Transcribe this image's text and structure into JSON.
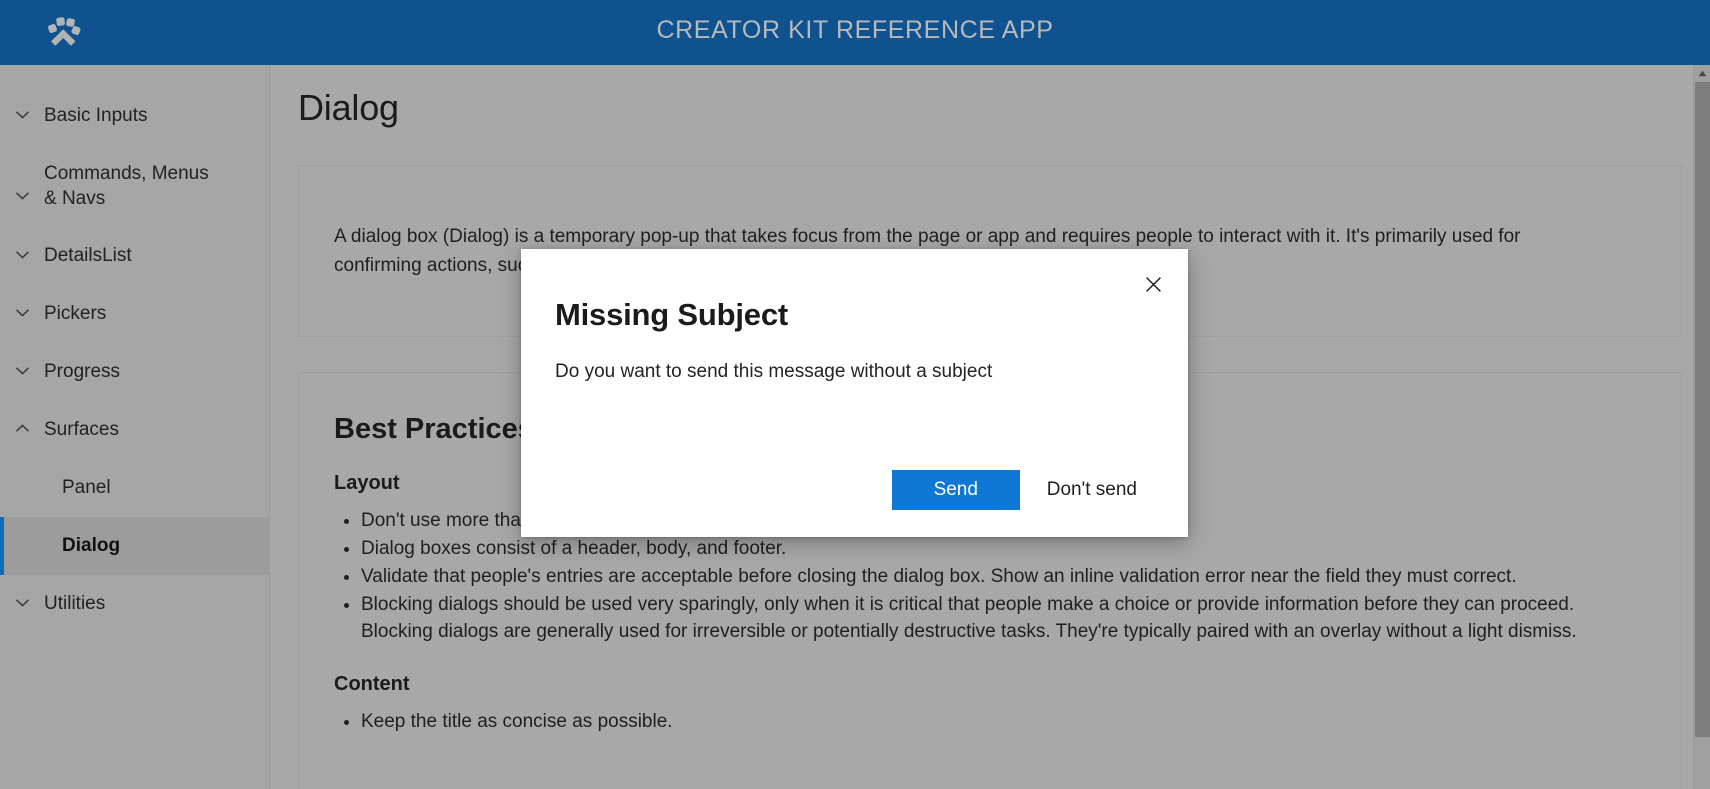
{
  "header": {
    "logo_icon": "paw-logo-icon",
    "title": "CREATOR KIT REFERENCE APP",
    "background_color": "#0e5390",
    "title_color": "#b9b9b9"
  },
  "sidebar": {
    "items": [
      {
        "label": "Basic Inputs",
        "icon": "chevron-down-icon",
        "expanded": false
      },
      {
        "label": "Commands, Menus & Navs",
        "icon": "chevron-down-icon",
        "expanded": false
      },
      {
        "label": "DetailsList",
        "icon": "chevron-down-icon",
        "expanded": false
      },
      {
        "label": "Pickers",
        "icon": "chevron-down-icon",
        "expanded": false
      },
      {
        "label": "Progress",
        "icon": "chevron-down-icon",
        "expanded": false
      },
      {
        "label": "Surfaces",
        "icon": "chevron-up-icon",
        "expanded": true
      },
      {
        "label": "Utilities",
        "icon": "chevron-down-icon",
        "expanded": false
      }
    ],
    "surfaces_children": [
      {
        "label": "Panel",
        "selected": false
      },
      {
        "label": "Dialog",
        "selected": true
      }
    ],
    "selection_accent_color": "#0f6cbd",
    "background_color": "#a6a6a6"
  },
  "main": {
    "page_title": "Dialog",
    "description": "A dialog box (Dialog) is a temporary pop-up that takes focus from the page or app and requires people to interact with it. It's primarily used for confirming actions, such as deleting a file, or asking people to make a choice.",
    "best_practices_heading": "Best Practices",
    "layout_heading": "Layout",
    "layout_bullets": [
      "Don't use more than three buttons.",
      "Dialog boxes consist of a header, body, and footer.",
      "Validate that people's entries are acceptable before closing the dialog box. Show an inline validation error near the field they must correct.",
      "Blocking dialogs should be used very sparingly, only when it is critical that people make a choice or provide information before they can proceed. Blocking dialogs are generally used for irreversible or potentially destructive tasks. They're typically paired with an overlay without a light dismiss."
    ],
    "content_heading": "Content",
    "content_bullets": [
      "Keep the title as concise as possible."
    ]
  },
  "scrollbar": {
    "up_arrow_icon": "scroll-up-arrow-icon"
  },
  "dialog": {
    "title": "Missing Subject",
    "subtext": "Do you want to send this message without a subject",
    "close_icon": "close-x-icon",
    "primary_button": "Send",
    "secondary_button": "Don't send",
    "primary_color": "#0f78d4",
    "background_color": "#ffffff"
  }
}
